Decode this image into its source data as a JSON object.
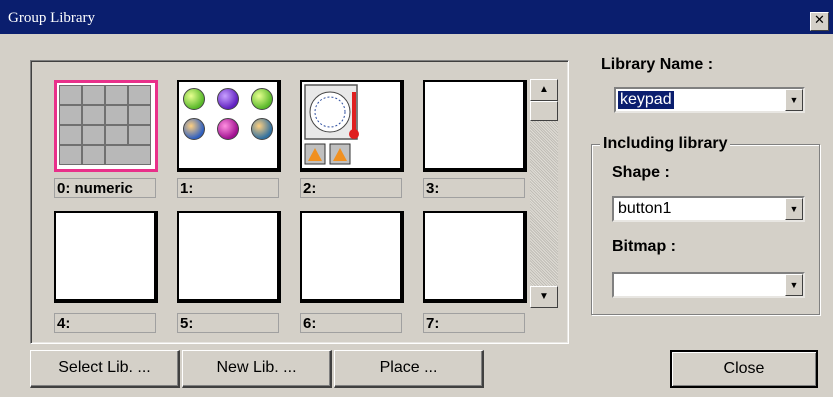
{
  "window": {
    "title": "Group Library",
    "close_glyph": "✕"
  },
  "gallery": {
    "tiles": [
      {
        "label": "0: numeric",
        "selected": true,
        "preview": "keypad-grid-icon"
      },
      {
        "label": "1:",
        "preview": "buttons-icon"
      },
      {
        "label": "2:",
        "preview": "dial-meter-icon"
      },
      {
        "label": "3:"
      },
      {
        "label": "4:"
      },
      {
        "label": "5:"
      },
      {
        "label": "6:"
      },
      {
        "label": "7:"
      }
    ],
    "scroll_up": "▲",
    "scroll_down": "▼"
  },
  "buttons": {
    "select_lib": "Select Lib. ...",
    "new_lib": "New Lib. ...",
    "place": "Place ...",
    "close": "Close"
  },
  "library": {
    "name_label": "Library  Name :",
    "name_value": "keypad",
    "including_label": "Including library",
    "shape_label": "Shape :",
    "shape_value": "button1",
    "bitmap_label": "Bitmap :",
    "bitmap_value": ""
  },
  "colors": {
    "titlebar": "#0a1e6e",
    "dialog": "#d4d0c8",
    "selection_border": "#e8308a"
  }
}
